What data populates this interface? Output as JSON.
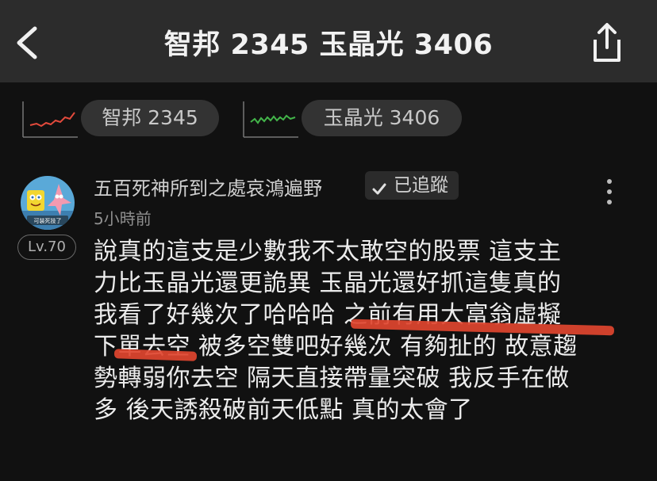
{
  "header": {
    "title": "智邦 2345 玉晶光 3406"
  },
  "tickers": [
    {
      "label": "智邦 2345",
      "trend_color": "#e34a3c"
    },
    {
      "label": "玉晶光 3406",
      "trend_color": "#43b54a"
    }
  ],
  "post": {
    "author": "五百死神所到之處哀鴻遍野",
    "follow_label": "已追蹤",
    "time": "5小時前",
    "level": "Lv.70",
    "avatar_caption": "可装死技了",
    "lines": [
      "說真的這支是少數我不太敢空的股票 這支主",
      "力比玉晶光還更詭異 玉晶光還好抓這隻真的",
      "我看了好幾次了哈哈哈 之前有用大富翁虛擬",
      "下單去空 被多空雙吧好幾次 有夠扯的 故意趨",
      "勢轉弱你去空 隔天直接帶量突破 我反手在做",
      "多 後天誘殺破前天低點 真的太會了"
    ]
  }
}
